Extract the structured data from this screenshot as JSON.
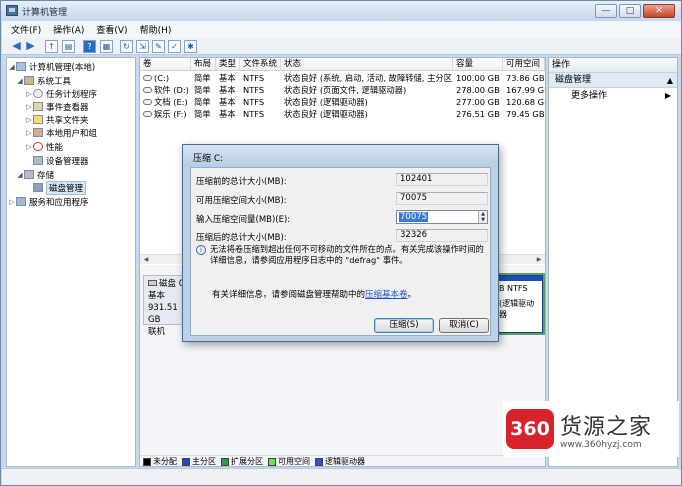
{
  "window": {
    "title": "计算机管理",
    "controls": [
      "—",
      "□",
      "✕"
    ]
  },
  "menu": [
    "文件(F)",
    "操作(A)",
    "查看(V)",
    "帮助(H)"
  ],
  "toolbar_icons": [
    "back-icon",
    "forward-icon",
    "up-icon",
    "show-tree-icon",
    "help-icon",
    "properties-icon",
    "refresh-icon",
    "export-icon",
    "settings-icon",
    "check-icon",
    "more-icon"
  ],
  "tree": {
    "items": [
      {
        "label": "计算机管理(本地)",
        "icon": "computer-icon"
      },
      {
        "label": "系统工具",
        "icon": "tools-icon"
      },
      {
        "label": "任务计划程序",
        "icon": "clock-icon"
      },
      {
        "label": "事件查看器",
        "icon": "event-icon"
      },
      {
        "label": "共享文件夹",
        "icon": "shared-folder-icon"
      },
      {
        "label": "本地用户和组",
        "icon": "users-icon"
      },
      {
        "label": "性能",
        "icon": "performance-icon"
      },
      {
        "label": "设备管理器",
        "icon": "device-icon"
      },
      {
        "label": "存储",
        "icon": "storage-icon"
      },
      {
        "label": "磁盘管理",
        "icon": "disk-icon"
      },
      {
        "label": "服务和应用程序",
        "icon": "services-icon"
      }
    ]
  },
  "volumes": {
    "headers": [
      "卷",
      "布局",
      "类型",
      "文件系统",
      "状态",
      "容量",
      "可用空间"
    ],
    "rows": [
      [
        "(C:)",
        "简单",
        "基本",
        "NTFS",
        "状态良好 (系统, 启动, 活动, 故障转储, 主分区)",
        "100.00 GB",
        "73.86 GB"
      ],
      [
        "软件 (D:)",
        "简单",
        "基本",
        "NTFS",
        "状态良好 (页面文件, 逻辑驱动器)",
        "278.00 GB",
        "167.99 GB"
      ],
      [
        "文档 (E:)",
        "简单",
        "基本",
        "NTFS",
        "状态良好 (逻辑驱动器)",
        "277.00 GB",
        "120.68 GB"
      ],
      [
        "娱乐 (F:)",
        "简单",
        "基本",
        "NTFS",
        "状态良好 (逻辑驱动器)",
        "276.51 GB",
        "79.45 GB"
      ]
    ]
  },
  "disk": {
    "name": "磁盘 0",
    "type": "基本",
    "size": "931.51 GB",
    "status": "联机",
    "partition_fs": "B NTFS",
    "partition_status": "(逻辑驱动器"
  },
  "legend": [
    {
      "label": "未分配",
      "color": "#000000"
    },
    {
      "label": "主分区",
      "color": "#1e4bb7"
    },
    {
      "label": "扩展分区",
      "color": "#2e9e3c"
    },
    {
      "label": "可用空间",
      "color": "#6ee05a"
    },
    {
      "label": "逻辑驱动器",
      "color": "#2f4fd8"
    }
  ],
  "actions": {
    "header": "操作",
    "section": "磁盘管理",
    "section_caret": "▲",
    "item": "更多操作",
    "item_caret": "▶"
  },
  "dialog": {
    "title": "压缩 C:",
    "rows": [
      {
        "label": "压缩前的总计大小(MB):",
        "value": "102401"
      },
      {
        "label": "可用压缩空间大小(MB):",
        "value": "70075"
      },
      {
        "label": "输入压缩空间量(MB)(E):",
        "value": "70075"
      },
      {
        "label": "压缩后的总计大小(MB):",
        "value": "32326"
      }
    ],
    "info_icon": "i",
    "info_text": "无法将卷压缩到超出任何不可移动的文件所在的点。有关完成该操作时间的详细信息，请参阅应用程序日志中的 \"defrag\" 事件。",
    "help_prefix": "有关详细信息，请参阅磁盘管理帮助中的",
    "help_link": "压缩基本卷",
    "help_suffix": "。",
    "ok_label": "压缩(S)",
    "cancel_label": "取消(C)"
  },
  "watermark": {
    "logo": "360",
    "name": "货源之家",
    "url": "www.360hyzj.com"
  }
}
